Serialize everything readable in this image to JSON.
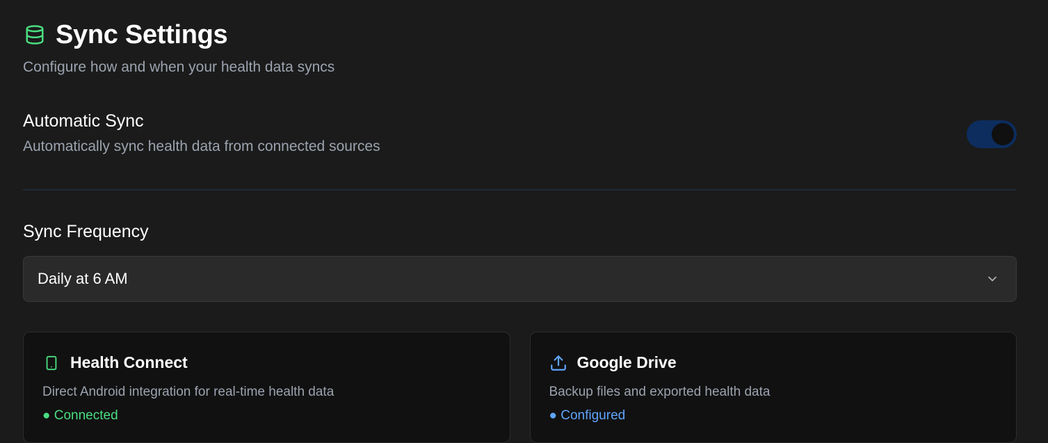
{
  "header": {
    "icon": "database-icon",
    "title": "Sync Settings",
    "subtitle": "Configure how and when your health data syncs"
  },
  "automatic_sync": {
    "title": "Automatic Sync",
    "description": "Automatically sync health data from connected sources",
    "enabled": true
  },
  "sync_frequency": {
    "title": "Sync Frequency",
    "selected": "Daily at 6 AM"
  },
  "cards": [
    {
      "icon": "smartphone-icon",
      "title": "Health Connect",
      "description": "Direct Android integration for real-time health data",
      "status": "● Connected",
      "status_color": "#4ade80"
    },
    {
      "icon": "upload-icon",
      "title": "Google Drive",
      "description": "Backup files and exported health data",
      "status": "● Configured",
      "status_color": "#60a5fa"
    }
  ],
  "colors": {
    "background": "#1b1b1b",
    "accent_green": "#4ade80",
    "accent_blue": "#60a5fa",
    "toggle_track": "#0c2d5e"
  }
}
